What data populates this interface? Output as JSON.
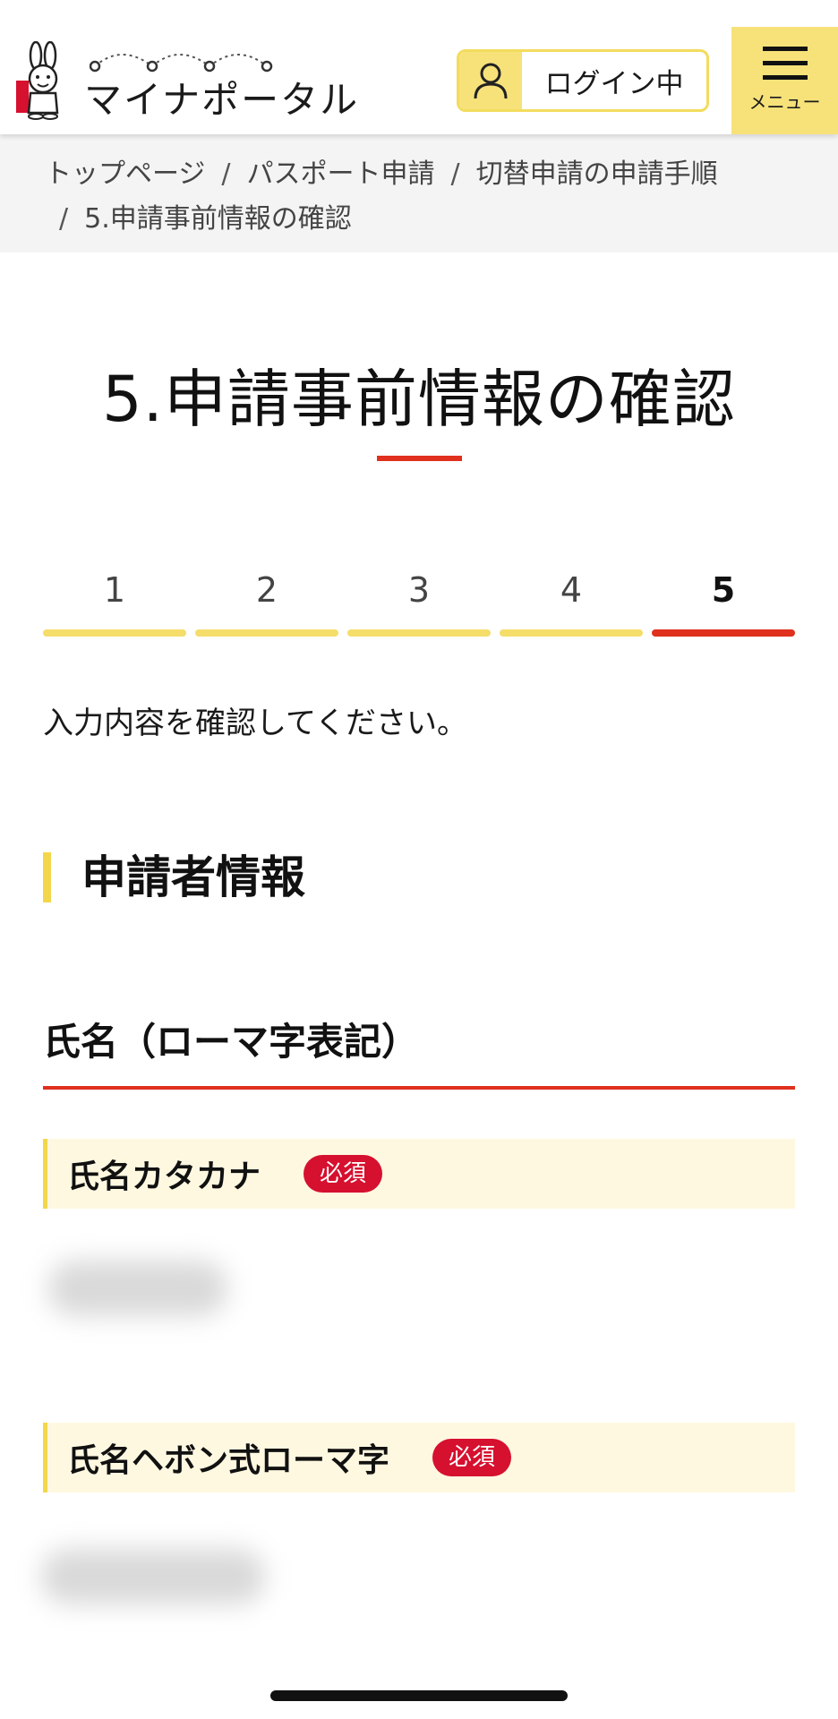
{
  "header": {
    "logo_text": "マイナポータル",
    "login_label": "ログイン中",
    "menu_label": "メニュー"
  },
  "breadcrumb": {
    "items": [
      "トップページ",
      "パスポート申請",
      "切替申請の申請手順",
      "5.申請事前情報の確認"
    ],
    "separator": "/"
  },
  "page": {
    "title": "5.申請事前情報の確認",
    "instruction": "入力内容を確認してください。"
  },
  "steps": {
    "items": [
      "1",
      "2",
      "3",
      "4",
      "5"
    ],
    "current": "5"
  },
  "section": {
    "heading": "申請者情報",
    "group_heading": "氏名（ローマ字表記）",
    "fields": [
      {
        "label": "氏名カタカナ",
        "badge": "必須"
      },
      {
        "label": "氏名ヘボン式ローマ字",
        "badge": "必須"
      }
    ]
  },
  "colors": {
    "accent_yellow": "#f7e27a",
    "accent_red": "#e0301e",
    "badge_red": "#d6102f",
    "label_bg": "#fff8e1"
  }
}
